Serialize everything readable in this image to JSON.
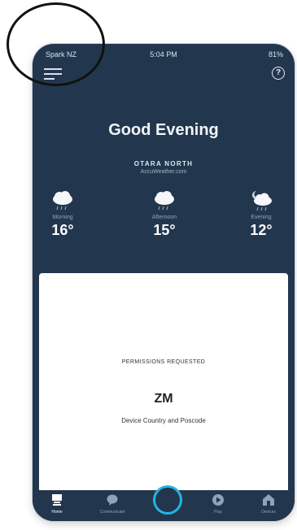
{
  "status_bar": {
    "carrier": "Spark NZ",
    "time": "5:04 PM",
    "battery": "81%"
  },
  "header": {
    "menu_icon": "hamburger-menu-icon",
    "help_icon": "question-circle-icon",
    "help_glyph": "?"
  },
  "greeting": "Good Evening",
  "weather": {
    "location": "OTARA NORTH",
    "source": "AccuWeather.com",
    "periods": [
      {
        "label": "Morning",
        "temp": "16°",
        "icon": "rain-cloud-icon"
      },
      {
        "label": "Afternoon",
        "temp": "15°",
        "icon": "rain-cloud-icon"
      },
      {
        "label": "Evening",
        "temp": "12°",
        "icon": "night-rain-cloud-icon"
      }
    ]
  },
  "card": {
    "title": "PERMISSIONS REQUESTED",
    "code": "ZM",
    "detail": "Device Country and Poscode"
  },
  "tabs": [
    {
      "label": "Home",
      "icon": "home-icon"
    },
    {
      "label": "Communicate",
      "icon": "chat-bubble-icon"
    },
    {
      "label": "",
      "icon": "alexa-ring-icon"
    },
    {
      "label": "Play",
      "icon": "play-icon"
    },
    {
      "label": "Devices",
      "icon": "devices-house-icon"
    }
  ],
  "colors": {
    "background": "#22374e",
    "accent": "#25b4e4",
    "card": "#ffffff"
  }
}
